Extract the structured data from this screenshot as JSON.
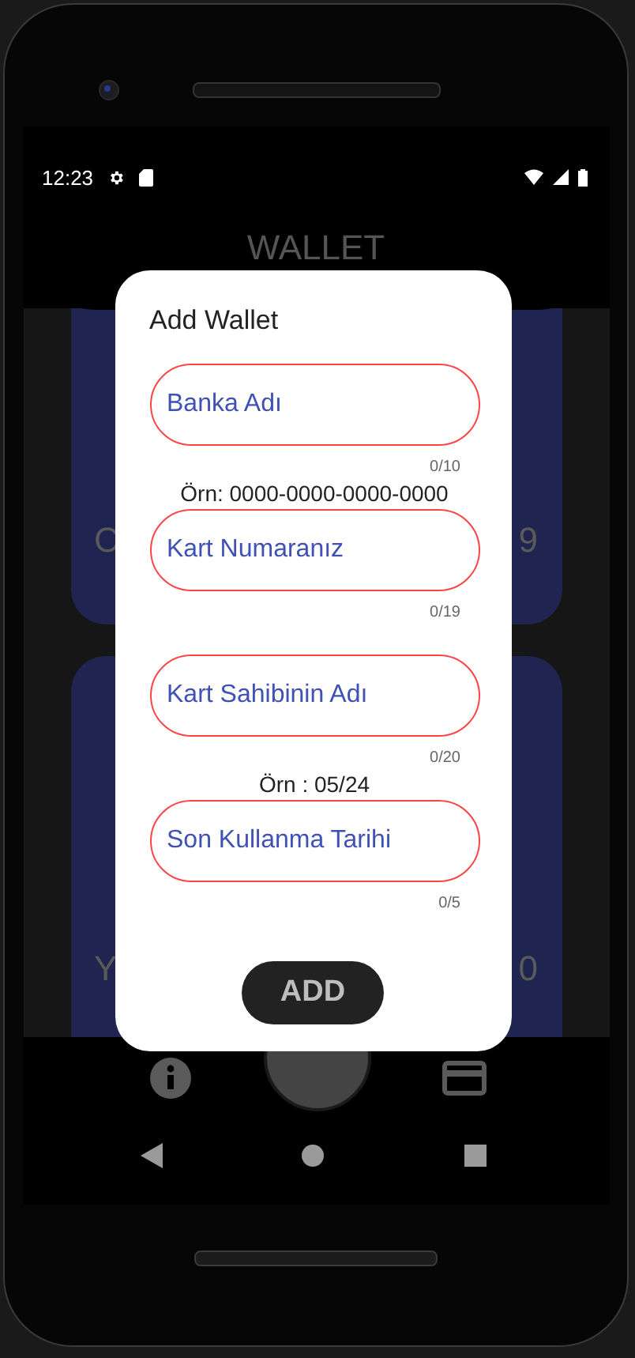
{
  "status_bar": {
    "time": "12:23"
  },
  "app": {
    "title": "WALLET"
  },
  "cards": [
    {
      "left_text": "C",
      "right_text": "9"
    },
    {
      "left_text": "Y",
      "right_text": "0"
    }
  ],
  "dialog": {
    "title": "Add Wallet",
    "fields": [
      {
        "placeholder": "Banka Adı",
        "counter": "0/10"
      },
      {
        "example": "Örn: 0000-0000-0000-0000",
        "placeholder": "Kart Numaranız",
        "counter": "0/19"
      },
      {
        "placeholder": "Kart Sahibinin Adı",
        "counter": "0/20"
      },
      {
        "example": "Örn : 05/24",
        "placeholder": "Son Kullanma Tarihi",
        "counter": "0/5"
      }
    ],
    "button": "ADD"
  }
}
